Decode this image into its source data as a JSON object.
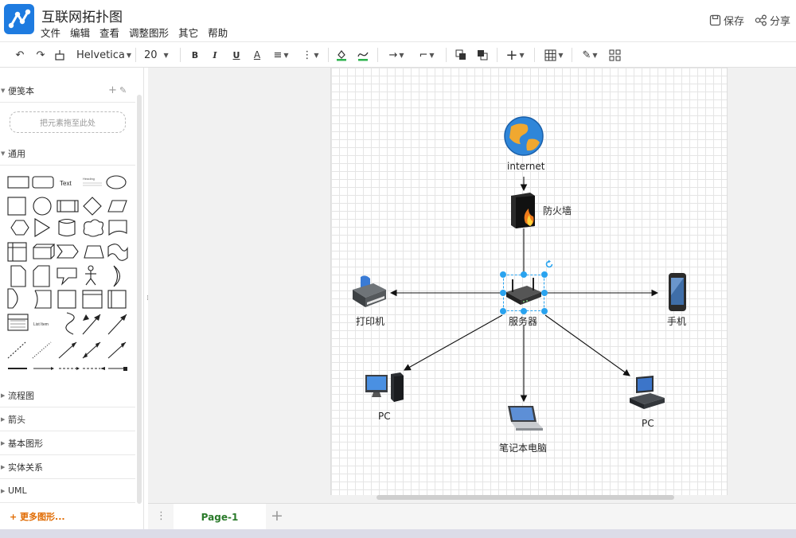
{
  "app": {
    "title": "互联网拓扑图"
  },
  "menu": [
    "文件",
    "编辑",
    "查看",
    "调整图形",
    "其它",
    "帮助"
  ],
  "header_actions": {
    "save": "保存",
    "share": "分享"
  },
  "toolbar": {
    "font_family": "Helvetica",
    "font_size": "20",
    "bold": "B",
    "italic": "I",
    "underline": "U",
    "font_color": "A"
  },
  "sidebar": {
    "scratchpad": "便笺本",
    "drop_hint": "把元素拖至此处",
    "general": "通用",
    "sample_text": "Text",
    "sample_heading": "Heading",
    "sample_list": "List Item",
    "sections": [
      "流程图",
      "箭头",
      "基本图形",
      "实体关系",
      "UML"
    ],
    "more_shapes": "+ 更多图形..."
  },
  "diagram": {
    "nodes": {
      "internet": "internet",
      "firewall": "防火墙",
      "server": "服务器",
      "printer": "打印机",
      "phone": "手机",
      "pc_left": "PC",
      "laptop": "笔记本电脑",
      "pc_right": "PC"
    }
  },
  "tabs": {
    "page": "Page-1"
  },
  "colors": {
    "accent": "#1e7be0",
    "selection": "#29a3ef",
    "tab_text": "#2a7a2a",
    "more_shapes": "#e06a00"
  }
}
